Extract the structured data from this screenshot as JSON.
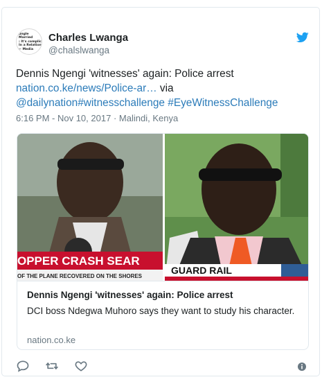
{
  "author": {
    "display_name": "Charles Lwanga",
    "screen_name": "@chalslwanga",
    "avatar_text": "ungle\nMarried\n: It's complicate\nIn a Relations\n~ Media"
  },
  "tweet": {
    "text_lead": "Dennis Ngengi 'witnesses' again: Police arrest",
    "link": "nation.co.ke/news/Police-ar…",
    "via": " via",
    "mention": "@dailynation",
    "hashtag1": "#witnesschallenge",
    "hashtag2": "#EyeWitnessChallenge",
    "timestamp": "6:16 PM - Nov 10, 2017",
    "separator": "·",
    "location": "Malindi, Kenya"
  },
  "card": {
    "banner_left": "OPPER CRASH SEAR",
    "ticker_left": "OF THE PLANE RECOVERED ON THE SHORES",
    "banner_right": "GUARD RAIL",
    "title": "Dennis Ngengi 'witnesses' again: Police arrest",
    "description": "DCI boss Ndegwa Muhoro says they want to study his character.",
    "domain": "nation.co.ke"
  },
  "icons": {
    "brand": "twitter-bird-icon",
    "reply": "reply-icon",
    "retweet": "retweet-icon",
    "like": "heart-icon",
    "info": "info-icon"
  },
  "colors": {
    "link": "#2b7bb9",
    "muted": "#697882",
    "twitter_blue": "#1da1f2"
  }
}
